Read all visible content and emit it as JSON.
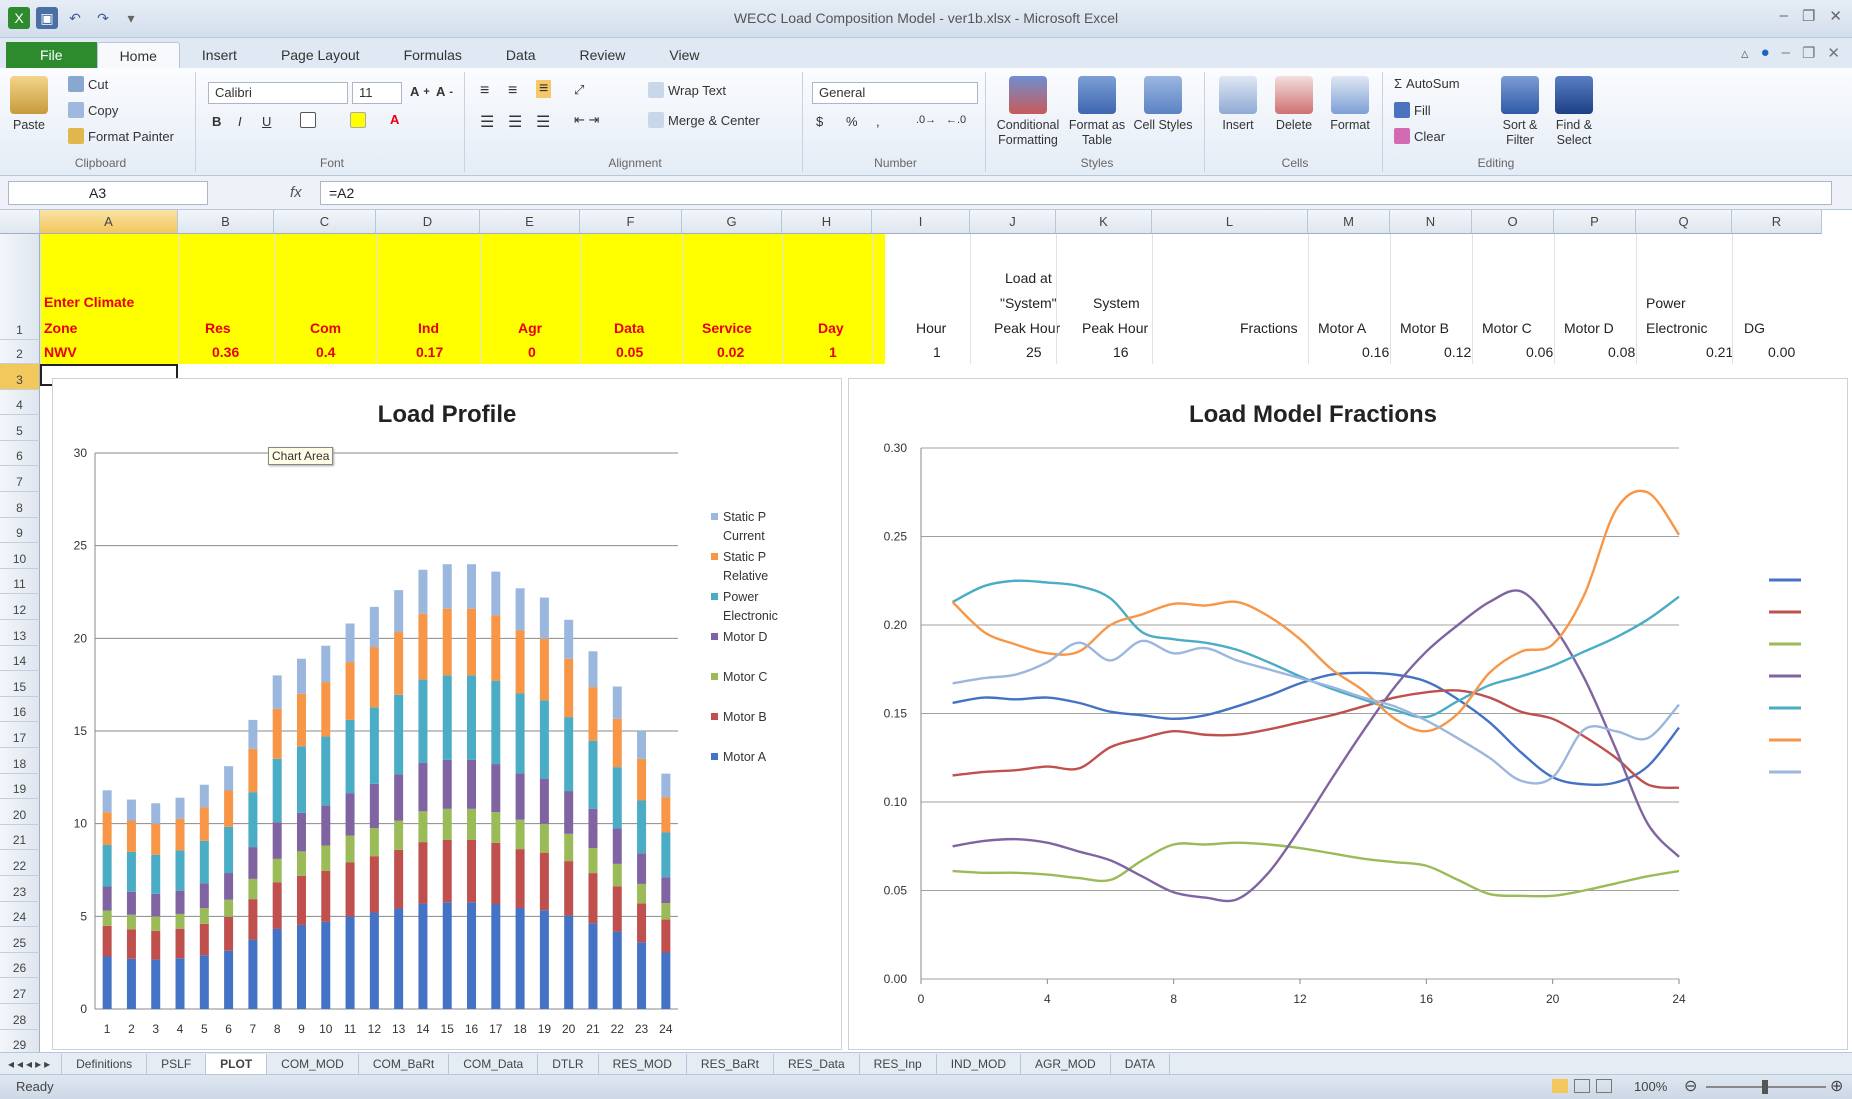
{
  "window": {
    "title": "WECC Load Composition Model - ver1b.xlsx - Microsoft Excel"
  },
  "ribbon_tabs": [
    "File",
    "Home",
    "Insert",
    "Page Layout",
    "Formulas",
    "Data",
    "Review",
    "View"
  ],
  "clipboard": {
    "paste": "Paste",
    "cut": "Cut",
    "copy": "Copy",
    "format_painter": "Format Painter",
    "label": "Clipboard"
  },
  "font": {
    "name": "Calibri",
    "size": "11",
    "label": "Font"
  },
  "alignment": {
    "wrap": "Wrap Text",
    "merge": "Merge & Center",
    "label": "Alignment"
  },
  "number": {
    "format": "General",
    "label": "Number"
  },
  "styles": {
    "conditional": "Conditional Formatting",
    "format_table": "Format as Table",
    "cell_styles": "Cell Styles",
    "label": "Styles"
  },
  "cells": {
    "insert": "Insert",
    "delete": "Delete",
    "format": "Format",
    "label": "Cells"
  },
  "editing": {
    "autosum": "AutoSum",
    "fill": "Fill",
    "clear": "Clear",
    "sort": "Sort & Filter",
    "find": "Find & Select",
    "label": "Editing"
  },
  "formula_bar": {
    "name_box": "A3",
    "fx": "fx",
    "formula": "=A2"
  },
  "columns": [
    "A",
    "B",
    "C",
    "D",
    "E",
    "F",
    "G",
    "H",
    "I",
    "J",
    "K",
    "L",
    "M",
    "N",
    "O",
    "P",
    "Q",
    "R"
  ],
  "rows": [
    "1",
    "2",
    "3",
    "4",
    "5",
    "6",
    "7",
    "8",
    "9",
    "10",
    "11",
    "12",
    "13",
    "14",
    "15",
    "16",
    "17",
    "18",
    "19",
    "20",
    "21",
    "22",
    "23",
    "24",
    "25",
    "26",
    "27",
    "28",
    "29"
  ],
  "sheet": {
    "header_a": "Enter Climate",
    "header_a2": "Zone",
    "headers": [
      "Res",
      "Com",
      "Ind",
      "Agr",
      "Data",
      "Service",
      "Day"
    ],
    "hour": "Hour",
    "load_at_l1": "Load at",
    "load_at_l2": "\"System\"",
    "load_at_l3": "Peak Hour",
    "sys_l1": "System",
    "sys_l2": "Peak Hour",
    "fractions": "Fractions",
    "motor_a": "Motor A",
    "motor_b": "Motor B",
    "motor_c": "Motor C",
    "motor_d": "Motor D",
    "power_l1": "Power",
    "power_l2": "Electronic",
    "dg": "DG",
    "row2": {
      "zone": "NWV",
      "res": "0.36",
      "com": "0.4",
      "ind": "0.17",
      "agr": "0",
      "data": "0.05",
      "service": "0.02",
      "day": "1",
      "hour": "1",
      "load": "25",
      "sys": "16",
      "ma": "0.16",
      "mb": "0.12",
      "mc": "0.06",
      "md": "0.08",
      "pe": "0.21",
      "dg": "0.00"
    }
  },
  "tooltip": "Chart Area",
  "sheet_tabs": [
    "Definitions",
    "PSLF",
    "PLOT",
    "COM_MOD",
    "COM_BaRt",
    "COM_Data",
    "DTLR",
    "RES_MOD",
    "RES_BaRt",
    "RES_Data",
    "RES_Inp",
    "IND_MOD",
    "AGR_MOD",
    "DATA"
  ],
  "active_sheet": "PLOT",
  "status": {
    "ready": "Ready",
    "zoom": "100%"
  },
  "colors": {
    "motor_a": "#4472C4",
    "motor_b": "#C0504D",
    "motor_c": "#9BBB59",
    "motor_d": "#8064A2",
    "power_electronic": "#4BACC6",
    "static_p_relative": "#F79646",
    "static_p_current": "#9BB7DE"
  },
  "chart_data": [
    {
      "type": "bar",
      "stacked": true,
      "title": "Load Profile",
      "categories": [
        "1",
        "2",
        "3",
        "4",
        "5",
        "6",
        "7",
        "8",
        "9",
        "10",
        "11",
        "12",
        "13",
        "14",
        "15",
        "16",
        "17",
        "18",
        "19",
        "20",
        "21",
        "22",
        "23",
        "24"
      ],
      "ylim": [
        0,
        30
      ],
      "yticks": [
        0,
        5,
        10,
        15,
        20,
        25,
        30
      ],
      "legend": [
        "Static P Current",
        "Static P Relative",
        "Power Electronic",
        "Motor D",
        "Motor C",
        "Motor B",
        "Motor A"
      ],
      "totals": [
        11.8,
        11.3,
        11.1,
        11.4,
        12.1,
        13.1,
        15.6,
        18.0,
        18.9,
        19.6,
        20.8,
        21.7,
        22.6,
        23.7,
        24.0,
        24.0,
        23.6,
        22.7,
        22.2,
        21.0,
        19.3,
        17.4,
        15.0,
        12.7
      ]
    },
    {
      "type": "line",
      "title": "Load Model Fractions",
      "xlim": [
        0,
        24
      ],
      "xticks": [
        0,
        4,
        8,
        12,
        16,
        20,
        24
      ],
      "ylim": [
        0,
        0.3
      ],
      "yticks": [
        "0.00",
        "0.05",
        "0.10",
        "0.15",
        "0.20",
        "0.25",
        "0.30"
      ],
      "x": [
        1,
        2,
        3,
        4,
        5,
        6,
        7,
        8,
        9,
        10,
        11,
        12,
        13,
        14,
        15,
        16,
        17,
        18,
        19,
        20,
        21,
        22,
        23,
        24
      ],
      "series": [
        {
          "key": "motor_a",
          "values": [
            0.156,
            0.159,
            0.158,
            0.159,
            0.156,
            0.151,
            0.149,
            0.147,
            0.149,
            0.154,
            0.16,
            0.167,
            0.172,
            0.173,
            0.172,
            0.168,
            0.158,
            0.145,
            0.128,
            0.114,
            0.11,
            0.111,
            0.12,
            0.142
          ]
        },
        {
          "key": "motor_b",
          "values": [
            0.115,
            0.117,
            0.118,
            0.12,
            0.119,
            0.131,
            0.136,
            0.14,
            0.138,
            0.138,
            0.141,
            0.145,
            0.149,
            0.154,
            0.159,
            0.162,
            0.163,
            0.159,
            0.151,
            0.147,
            0.137,
            0.125,
            0.11,
            0.108
          ]
        },
        {
          "key": "motor_c",
          "values": [
            0.061,
            0.06,
            0.06,
            0.059,
            0.057,
            0.056,
            0.067,
            0.076,
            0.076,
            0.077,
            0.076,
            0.074,
            0.071,
            0.068,
            0.066,
            0.064,
            0.056,
            0.048,
            0.047,
            0.047,
            0.05,
            0.054,
            0.058,
            0.061
          ]
        },
        {
          "key": "motor_d",
          "values": [
            0.075,
            0.078,
            0.079,
            0.077,
            0.072,
            0.067,
            0.058,
            0.049,
            0.046,
            0.045,
            0.06,
            0.085,
            0.113,
            0.14,
            0.165,
            0.185,
            0.2,
            0.213,
            0.219,
            0.2,
            0.17,
            0.13,
            0.088,
            0.069
          ]
        },
        {
          "key": "power_electronic",
          "values": [
            0.213,
            0.222,
            0.225,
            0.224,
            0.222,
            0.215,
            0.196,
            0.192,
            0.19,
            0.186,
            0.179,
            0.171,
            0.164,
            0.158,
            0.152,
            0.148,
            0.157,
            0.166,
            0.171,
            0.177,
            0.185,
            0.193,
            0.203,
            0.216
          ]
        },
        {
          "key": "static_p_relative",
          "values": [
            0.213,
            0.196,
            0.189,
            0.184,
            0.185,
            0.2,
            0.206,
            0.212,
            0.211,
            0.213,
            0.205,
            0.192,
            0.175,
            0.163,
            0.147,
            0.14,
            0.15,
            0.173,
            0.185,
            0.189,
            0.217,
            0.265,
            0.275,
            0.251
          ]
        },
        {
          "key": "static_p_current",
          "values": [
            0.167,
            0.17,
            0.172,
            0.179,
            0.19,
            0.18,
            0.191,
            0.184,
            0.187,
            0.18,
            0.175,
            0.17,
            0.165,
            0.159,
            0.154,
            0.146,
            0.136,
            0.125,
            0.112,
            0.114,
            0.141,
            0.14,
            0.136,
            0.155
          ]
        }
      ]
    }
  ]
}
